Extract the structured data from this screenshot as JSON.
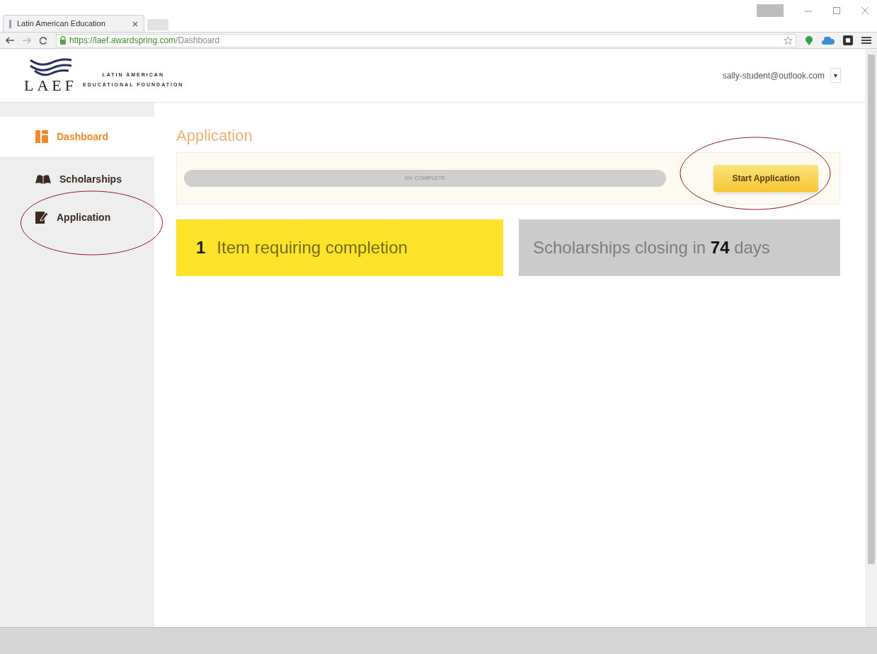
{
  "browser": {
    "tab_title": "Latin American Education",
    "url_host": "https://laef.awardspring.com",
    "url_path": "/Dashboard"
  },
  "header": {
    "logo_text": "LAEF",
    "org_line_1": "LATIN AMERICAN",
    "org_line_2": "EDUCATIONAL FOUNDATION",
    "account": "sally-student@outlook.com",
    "account_caret": "▾"
  },
  "sidebar": {
    "items": [
      {
        "label": "Dashboard",
        "kind": "dashboard",
        "selected": true
      },
      {
        "label": "Scholarships",
        "kind": "scholarships",
        "selected": false
      },
      {
        "label": "Application",
        "kind": "application",
        "selected": false
      }
    ]
  },
  "main": {
    "title": "Application",
    "progress": {
      "level": 0,
      "label": "0% COMPLETE"
    },
    "button": "Start Application",
    "cards": [
      {
        "kind": "items",
        "count": "1",
        "text": "Item requiring completion"
      },
      {
        "kind": "deadline",
        "text": "Scholarships closing in **74** days"
      }
    ]
  }
}
